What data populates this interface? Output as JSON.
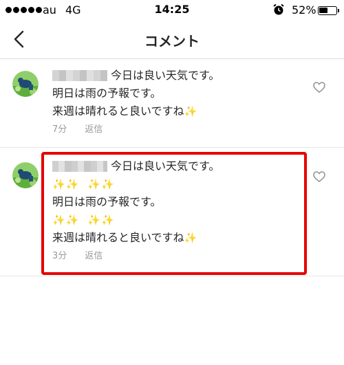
{
  "status_bar": {
    "carrier": "au",
    "network": "4G",
    "time": "14:25",
    "battery": "52%",
    "battery_level": 0.52,
    "icons": [
      "signal-dots-icon",
      "alarm-clock-icon",
      "battery-icon"
    ]
  },
  "header": {
    "title": "コメント",
    "back_icon": "chevron-left-icon"
  },
  "comments": [
    {
      "first_line": "今日は良い天気です。",
      "line2": "明日は雨の予報です。",
      "line3_text": "来週は晴れると良いですね",
      "sparkle": "✨",
      "time": "7分",
      "reply": "返信",
      "like_icon": "heart-outline-icon"
    },
    {
      "first_line": "今日は良い天気です。",
      "sparkle_row": "✨✨",
      "line2": "明日は雨の予報です。",
      "line3_text": "来週は晴れると良いですね",
      "sparkle": "✨",
      "time": "3分",
      "reply": "返信",
      "like_icon": "heart-outline-icon"
    }
  ],
  "colors": {
    "highlight": "#e60000",
    "meta_text": "#999999",
    "divider": "#e6e6e6"
  }
}
